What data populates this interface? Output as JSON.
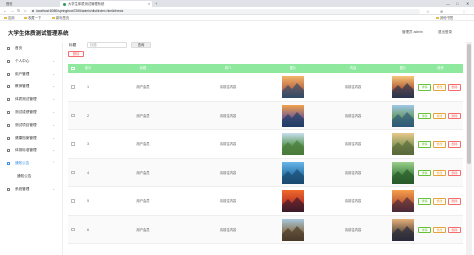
{
  "browser": {
    "tabs": [
      {
        "label": "首页"
      },
      {
        "label": "大学生体质测试管理系统"
      }
    ],
    "new_tab": "+",
    "window_controls": [
      "—",
      "□",
      "✕"
    ],
    "url": "localhost:8080/springboot7265/admin/dist/index.html#/news",
    "extensions": [
      "☆",
      "⊕",
      "⋮"
    ],
    "nav": [
      "←",
      "→",
      "↻",
      "⌂"
    ],
    "bookmarks": [
      {
        "label": "应用"
      },
      {
        "label": "收藏一下"
      },
      {
        "label": "新标签页"
      }
    ],
    "bookmarks_right": "其他书签"
  },
  "header": {
    "title": "大学生体质测试管理系统",
    "user": "管理员 admin",
    "logout": "退出登录"
  },
  "sidebar": {
    "items": [
      {
        "label": "首页",
        "icon": "home-icon",
        "chevron": ""
      },
      {
        "label": "个人中心",
        "icon": "user-icon",
        "chevron": "⌄"
      },
      {
        "label": "用户管理",
        "icon": "users-icon",
        "chevron": "⌄"
      },
      {
        "label": "教师管理",
        "icon": "teacher-icon",
        "chevron": "⌄"
      },
      {
        "label": "体质测试管理",
        "icon": "test-icon",
        "chevron": "⌄"
      },
      {
        "label": "测试成绩管理",
        "icon": "score-icon",
        "chevron": "⌄"
      },
      {
        "label": "测试项目管理",
        "icon": "project-icon",
        "chevron": "⌄"
      },
      {
        "label": "健康档案管理",
        "icon": "health-icon",
        "chevron": "⌄"
      },
      {
        "label": "体测标准管理",
        "icon": "standard-icon",
        "chevron": "⌄"
      },
      {
        "label": "通知公告",
        "icon": "notice-icon",
        "chevron": "⌃",
        "active": true
      },
      {
        "label": "通知公告",
        "icon": "",
        "chevron": "",
        "sub": true
      },
      {
        "label": "系统管理",
        "icon": "settings-icon",
        "chevron": "⌄"
      }
    ]
  },
  "search": {
    "label": "标题",
    "placeholder": "标题",
    "button": "查询"
  },
  "actions": {
    "delete": "删除"
  },
  "table": {
    "columns": [
      "索引",
      "标题",
      "简介",
      "图片",
      "内容",
      "图片",
      "操作"
    ],
    "rows": [
      {
        "index": "1",
        "title": "用户会员",
        "intro": "请前往内容",
        "image1": "lake-sunset",
        "content": "请前往内容",
        "image2": "mountain-sunset"
      },
      {
        "index": "2",
        "title": "用户会员",
        "intro": "请前往内容",
        "image1": "sea-sunset",
        "content": "请前往内容",
        "image2": "mountain-lake"
      },
      {
        "index": "3",
        "title": "用户会员",
        "intro": "请前往内容",
        "image1": "alpine-lake",
        "content": "请前往内容",
        "image2": "castle-hill"
      },
      {
        "index": "4",
        "title": "用户会员",
        "intro": "请前往内容",
        "image1": "fishing-boat",
        "content": "请前往内容",
        "image2": "forest-cabin"
      },
      {
        "index": "5",
        "title": "用户会员",
        "intro": "请前往内容",
        "image1": "red-sunset",
        "content": "请前往内容",
        "image2": "desert-sunset"
      },
      {
        "index": "6",
        "title": "用户会员",
        "intro": "请前往内容",
        "image1": "coastal-rocks",
        "content": "请前往内容",
        "image2": "pagoda-cliff"
      }
    ],
    "row_buttons": {
      "detail": "详情",
      "edit": "修改",
      "delete": "删除"
    }
  },
  "colors": {
    "table_header": "#8ee89e",
    "detail": "#67c23a",
    "edit": "#e6a23c",
    "delete": "#f56c6c"
  }
}
